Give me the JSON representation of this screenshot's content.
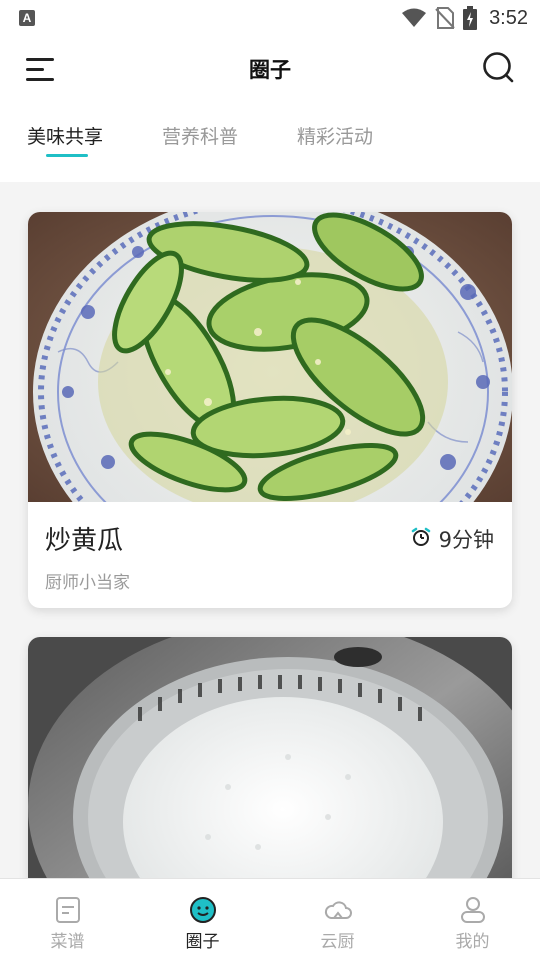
{
  "status_bar": {
    "app_icon_letter": "A",
    "time": "3:52"
  },
  "header": {
    "title": "圈子"
  },
  "tabs": [
    {
      "label": "美味共享",
      "active": true
    },
    {
      "label": "营养科普",
      "active": false
    },
    {
      "label": "精彩活动",
      "active": false
    }
  ],
  "feed": [
    {
      "title": "炒黄瓜",
      "author": "厨师小当家",
      "time": "9分钟"
    }
  ],
  "bottom_nav": [
    {
      "label": "菜谱",
      "icon": "recipe-book-icon",
      "active": false
    },
    {
      "label": "圈子",
      "icon": "smiley-chat-icon",
      "active": true
    },
    {
      "label": "云厨",
      "icon": "cloud-icon",
      "active": false
    },
    {
      "label": "我的",
      "icon": "user-icon",
      "active": false
    }
  ],
  "colors": {
    "accent": "#1fbfc6",
    "inactive": "#aaaaaa",
    "background": "#f4f4f4"
  }
}
